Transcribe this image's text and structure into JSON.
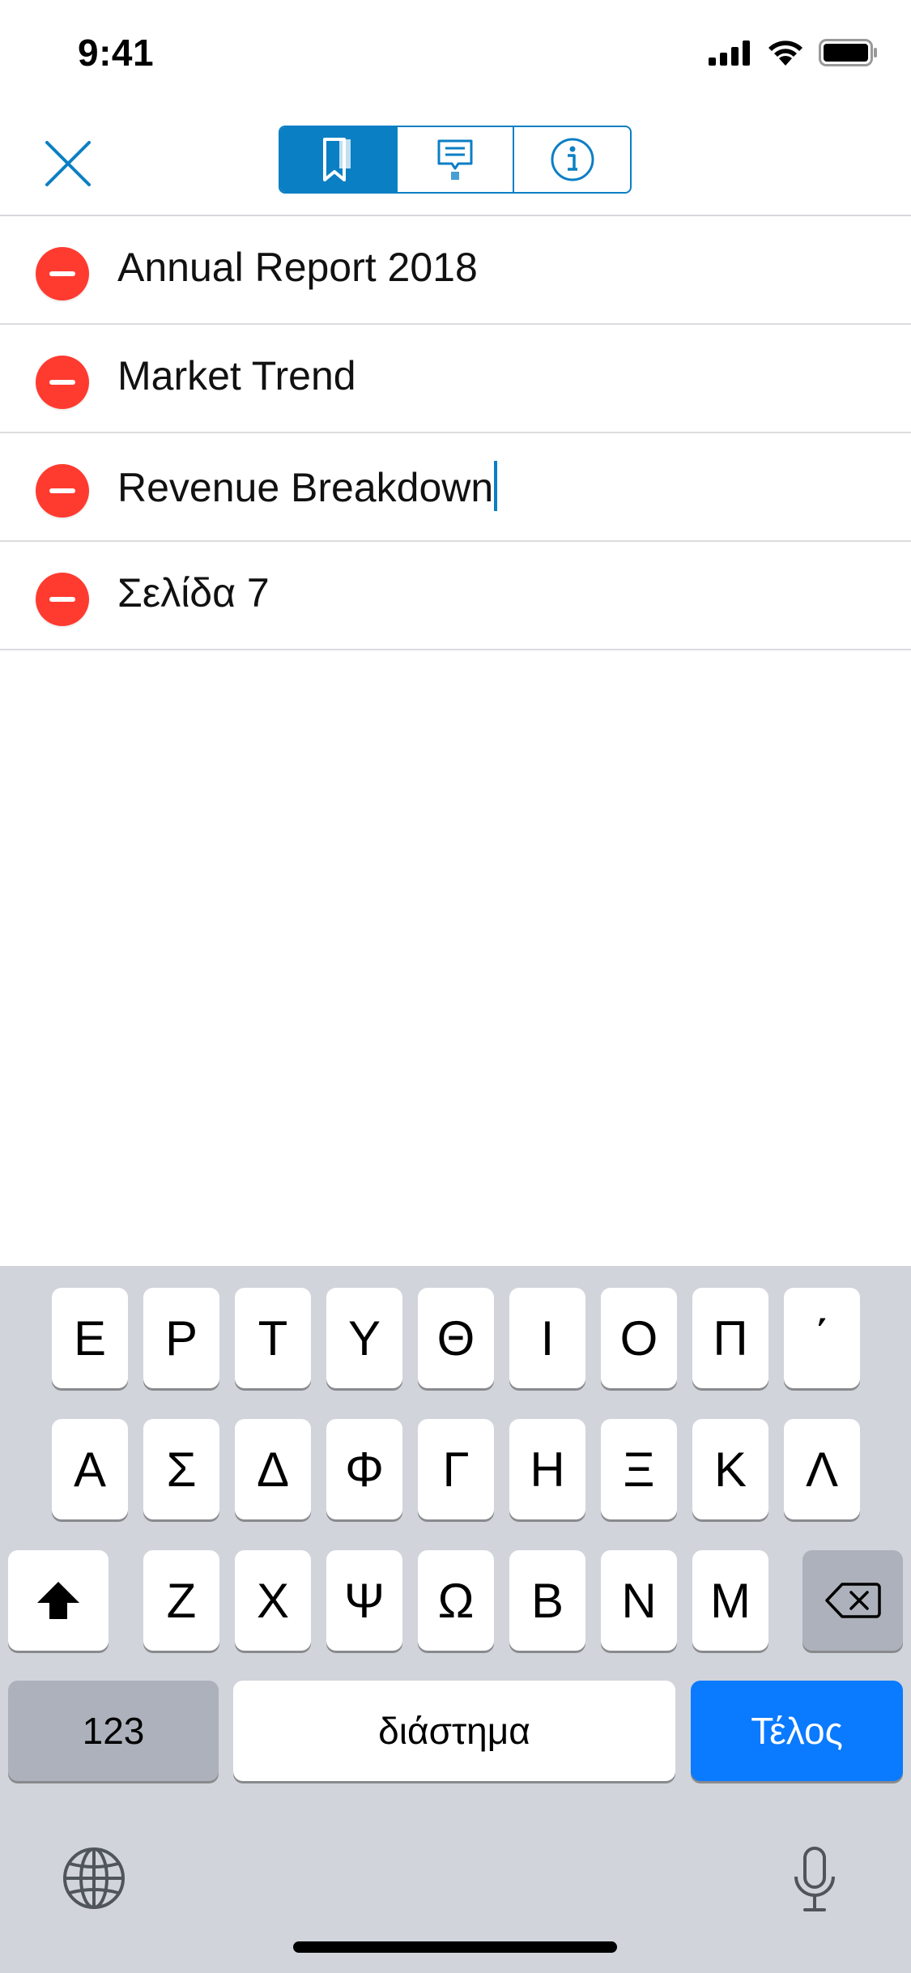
{
  "status_bar": {
    "time": "9:41",
    "icons": [
      "signal-icon",
      "wifi-icon",
      "battery-icon"
    ]
  },
  "nav": {
    "close_icon": "close-icon",
    "segments": [
      {
        "icon": "bookmark-icon",
        "active": true
      },
      {
        "icon": "comment-icon",
        "active": false
      },
      {
        "icon": "info-icon",
        "active": false
      }
    ],
    "accent_color": "#0b7fc4"
  },
  "bookmarks": [
    {
      "title": "Annual Report 2018"
    },
    {
      "title": "Market Trend"
    },
    {
      "title": "Revenue Breakdown",
      "editing": true
    },
    {
      "title": "Σελίδα 7"
    }
  ],
  "keyboard": {
    "row1": [
      "Ε",
      "Ρ",
      "Τ",
      "Υ",
      "Θ",
      "Ι",
      "Ο",
      "Π",
      "΄"
    ],
    "row2": [
      "Α",
      "Σ",
      "Δ",
      "Φ",
      "Γ",
      "Η",
      "Ξ",
      "Κ",
      "Λ"
    ],
    "row3": [
      "Ζ",
      "Χ",
      "Ψ",
      "Ω",
      "Β",
      "Ν",
      "Μ"
    ],
    "numbers_label": "123",
    "space_label": "διάστημα",
    "done_label": "Τέλος",
    "shift_icon": "shift-icon",
    "delete_icon": "backspace-icon",
    "globe_icon": "globe-icon",
    "mic_icon": "microphone-icon",
    "done_color": "#0a7aff",
    "delete_button_color": "#ff3b30"
  }
}
